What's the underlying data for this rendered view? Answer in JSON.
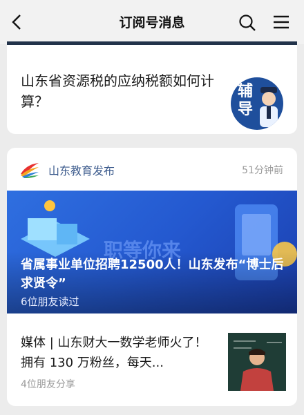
{
  "header": {
    "title": "订阅号消息",
    "icons": [
      "chevron-left-icon",
      "search-icon",
      "menu-icon"
    ]
  },
  "card1": {
    "headline": "山东省资源税的应纳税额如何计算？",
    "thumb_text": "辅导"
  },
  "card2": {
    "source": "山东教育发布",
    "time": "51分钟前",
    "banner_bg_text": "职等你来",
    "banner_title": "省属事业单位招聘12500人！山东发布“博士后求贤令”",
    "banner_meta": "6位朋友读过",
    "item": {
      "title": "媒体 | 山东财大一数学老师火了！拥有 130 万粉丝，每天...",
      "meta": "4位朋友分享"
    }
  }
}
